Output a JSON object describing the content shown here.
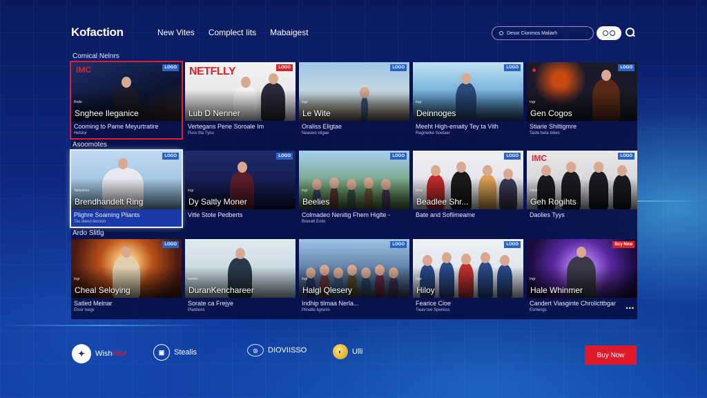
{
  "header": {
    "logo": "Kofaction",
    "nav": [
      "New Vites",
      "Complect Iits",
      "Mabaigest"
    ],
    "search_placeholder": "Desor Cionmos Maliarh"
  },
  "sections": [
    {
      "title": "Comical Nelnrs",
      "cards": [
        {
          "badge": "LOGO",
          "badge_color": "blue",
          "tag": "Rode",
          "title": "Snghee Ileganice",
          "desc": "Cooming to Pame Meyurtratire",
          "sub": "Helstor",
          "thumb": "dark-arena",
          "glyph": "IMC",
          "selected": "red"
        },
        {
          "badge": "LOGO",
          "badge_color": "red",
          "brand": "NETFLLY",
          "title": "Lub D Nenner",
          "desc": "Vertegans Perie Soroale Im",
          "sub": "Puss tha Tyou",
          "thumb": "two-men"
        },
        {
          "badge": "LOGO",
          "badge_color": "blue",
          "tag": "Ingr",
          "title": "Le Wite",
          "desc": "Oraliss Eligtae",
          "sub": "Neaswo stigae",
          "thumb": "ruins"
        },
        {
          "badge": "LOGO",
          "badge_color": "blue",
          "tag": "Ingr",
          "title": "Deinnoges",
          "desc": "Meeht High-emaity Tey ta Vith",
          "sub": "Ragmelke Soetaer",
          "thumb": "city-man"
        },
        {
          "badge": "LOGO",
          "badge_color": "blue",
          "tag": "Ingr",
          "title": "Gen Cogos",
          "desc": "Stiarie Shiltigmre",
          "sub": "Taste beta Iokes",
          "thumb": "robot",
          "glyph": "●"
        }
      ]
    },
    {
      "title": "Asoomotes",
      "cards": [
        {
          "badge": "LOGO",
          "badge_color": "blue",
          "tag": "Talasshes",
          "title": "Brendhandelt Ring",
          "desc": "Plighre Soaming Pliants",
          "sub": "Tas dieno leccion",
          "thumb": "portrait",
          "selected": "white"
        },
        {
          "badge": "LOGO",
          "badge_color": "blue",
          "tag": "Ingr",
          "title": "Dy Saltly Moner",
          "desc": "Vitle Stote Pedberts",
          "sub": "",
          "thumb": "suit-man"
        },
        {
          "badge": "LOGO",
          "badge_color": "blue",
          "tag": "Ingr",
          "title": "Beelies",
          "desc": "Colmadeo Nenitig Fhem Higlte -",
          "sub": "Boeratt Eoilo",
          "thumb": "crowd-field"
        },
        {
          "badge": "LOGO",
          "badge_color": "blue",
          "tag": "Intrs",
          "title": "Beadlee Shr...",
          "desc": "Bate and Soflimeame",
          "sub": "",
          "thumb": "heroes"
        },
        {
          "badge": "LOGO",
          "badge_color": "blue",
          "tag": "Gilmr",
          "title": "Geh Rogihts",
          "desc": "Daolies Tyys",
          "sub": "",
          "thumb": "suits",
          "glyph": "IMC"
        }
      ]
    },
    {
      "title": "Ardo Slitlg",
      "cards": [
        {
          "badge": "LOGO",
          "badge_color": "blue",
          "tag": "Ingr",
          "title": "Cheal Seloying",
          "desc": "Satled Melnar",
          "sub": "Etnsr lsegs",
          "thumb": "warrior"
        },
        {
          "badge": "",
          "badge_color": "",
          "tag": "Iwonts",
          "title": "DuranKenchareer",
          "desc": "Sorate ca Frejye",
          "sub": "Plantions",
          "thumb": "woman"
        },
        {
          "badge": "LOGO",
          "badge_color": "blue",
          "tag": "Ingr",
          "title": "Halgl Qlesery",
          "desc": "Indhip tilmaa Nerla...",
          "sub": "Plinatte ligrenls",
          "thumb": "big-crowd"
        },
        {
          "badge": "LOGO",
          "badge_color": "blue",
          "tag": "Ingr",
          "title": "Hiloy",
          "desc": "Fearice Cioe",
          "sub": "Tieav toe Sperioss",
          "thumb": "team"
        },
        {
          "badge": "Buy Now",
          "badge_color": "red",
          "tag": "Ingr",
          "title": "Hale Whinmer",
          "desc": "Candert Viasginte Chrolicttbgar",
          "sub": "Esnlerigs",
          "thumb": "purple-hero",
          "dots": "•••"
        }
      ]
    }
  ],
  "footer": {
    "partners": [
      {
        "icon": "wish-icon",
        "label": "Wish",
        "label_accent": "lolol"
      },
      {
        "icon": "stealis-icon",
        "label": "Stealis"
      },
      {
        "icon": "disc-icon",
        "label": "DIOVIISSO"
      },
      {
        "icon": "gold-icon",
        "label": "Ulli"
      }
    ],
    "buy_label": "Buy Now"
  },
  "colors": {
    "accent_red": "#e01a2a",
    "accent_blue": "#2a63c8",
    "panel": "#08104a"
  }
}
